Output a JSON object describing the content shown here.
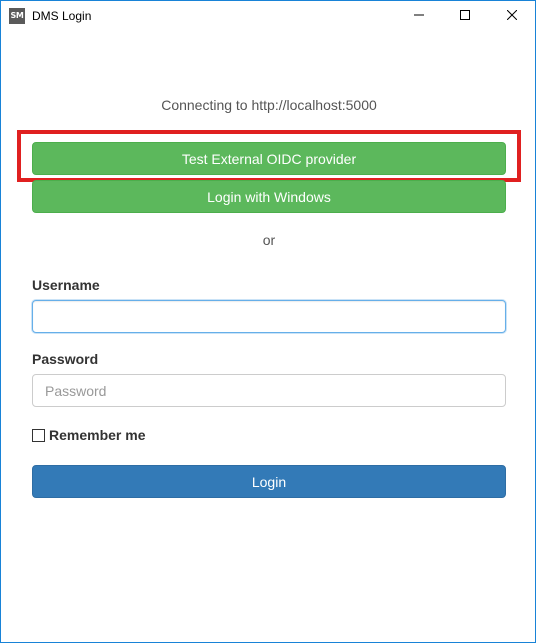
{
  "window": {
    "app_icon_text": "SM",
    "title": "DMS Login",
    "controls": {
      "minimize": "minimize-icon",
      "maximize": "maximize-icon",
      "close": "close-icon"
    }
  },
  "main": {
    "connecting_text": "Connecting to http://localhost:5000",
    "oidc_button_label": "Test External OIDC provider",
    "windows_button_label": "Login with Windows",
    "or_text": "or",
    "username_label": "Username",
    "username_value": "",
    "password_label": "Password",
    "password_placeholder": "Password",
    "remember_label": "Remember me",
    "remember_checked": false,
    "login_button_label": "Login"
  },
  "colors": {
    "green_button": "#5cb85c",
    "blue_button": "#337ab7",
    "highlight": "#e02020",
    "window_border": "#1883d7"
  }
}
